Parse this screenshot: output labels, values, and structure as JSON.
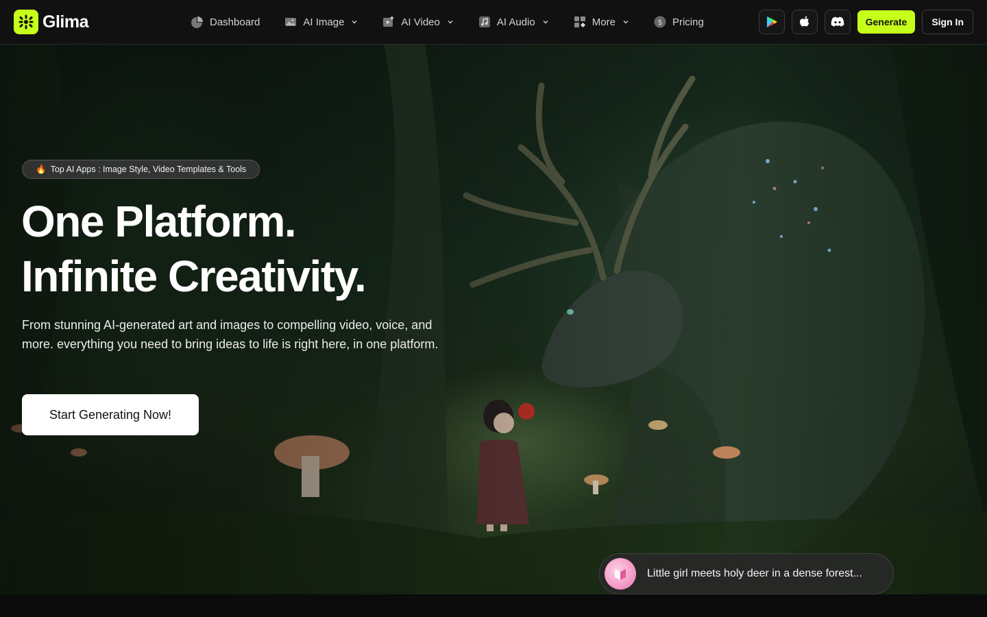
{
  "brand": {
    "name": "Glima",
    "accent": "#c6ff1a"
  },
  "nav": {
    "items": [
      {
        "label": "Dashboard",
        "icon": "dashboard-icon",
        "dropdown": false
      },
      {
        "label": "AI Image",
        "icon": "image-icon",
        "dropdown": true
      },
      {
        "label": "AI Video",
        "icon": "video-icon",
        "dropdown": true
      },
      {
        "label": "AI Audio",
        "icon": "music-icon",
        "dropdown": true
      },
      {
        "label": "More",
        "icon": "grid-icon",
        "dropdown": true
      },
      {
        "label": "Pricing",
        "icon": "dollar-icon",
        "dropdown": false
      }
    ],
    "apps": [
      "google-play-icon",
      "apple-icon",
      "discord-icon"
    ],
    "generate_label": "Generate",
    "signin_label": "Sign In"
  },
  "hero": {
    "badge_emoji": "🔥",
    "badge_text": "Top AI Apps : Image Style, Video Templates & Tools",
    "headline_line1": "One Platform.",
    "headline_line2": "Infinite Creativity.",
    "subhead": "From stunning AI-generated art and images to compelling video, voice, and more. everything you need to bring ideas to life is right here, in one platform.",
    "cta_label": "Start Generating Now!",
    "prompt_text": "Little girl meets holy deer in a dense forest..."
  }
}
